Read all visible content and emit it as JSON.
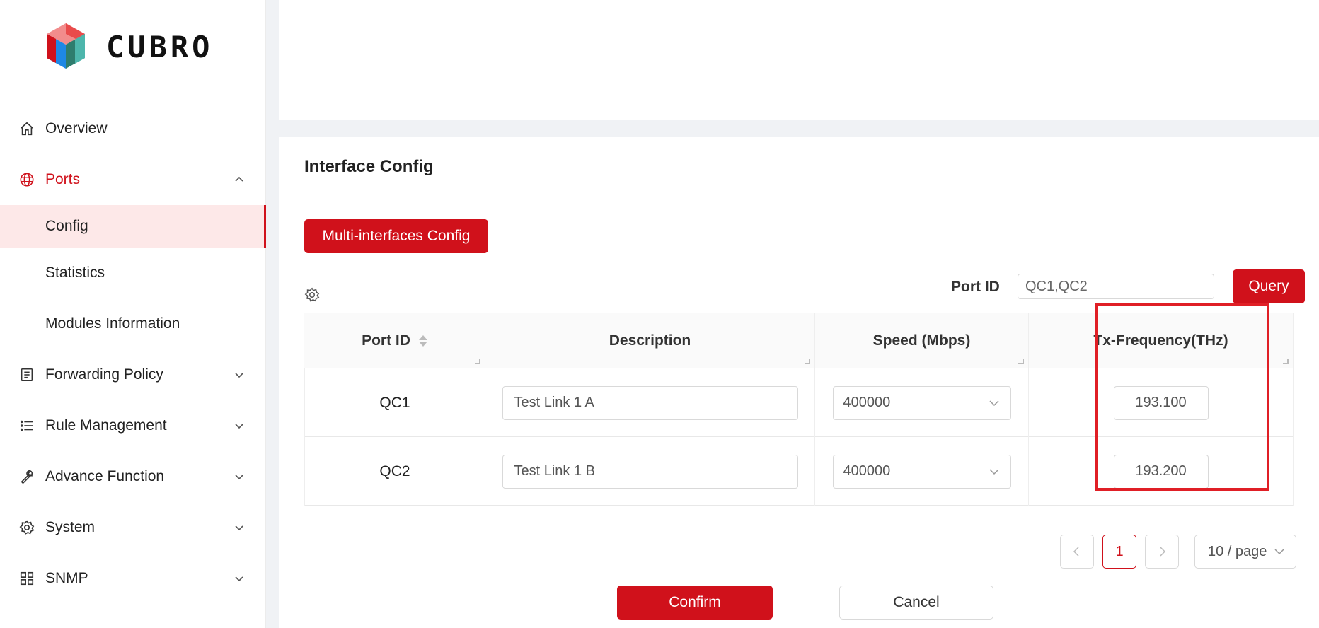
{
  "brand": {
    "name": "CUBRO",
    "colors": {
      "accent": "#d0111b",
      "highlight": "#e01f26",
      "selected_bg": "#fde8e8"
    }
  },
  "sidebar": {
    "items": [
      {
        "label": "Overview",
        "icon": "home-icon"
      },
      {
        "label": "Ports",
        "icon": "globe-icon",
        "expanded": true,
        "children": [
          {
            "label": "Config",
            "selected": true
          },
          {
            "label": "Statistics"
          },
          {
            "label": "Modules Information"
          }
        ]
      },
      {
        "label": "Forwarding Policy",
        "icon": "list-doc-icon"
      },
      {
        "label": "Rule Management",
        "icon": "list-icon"
      },
      {
        "label": "Advance Function",
        "icon": "wrench-icon"
      },
      {
        "label": "System",
        "icon": "gear-icon"
      },
      {
        "label": "SNMP",
        "icon": "grid-icon"
      }
    ]
  },
  "main": {
    "title": "Interface Config",
    "multi_button": "Multi-interfaces Config",
    "filter": {
      "label": "Port ID",
      "value": "QC1,QC2",
      "query_button": "Query"
    },
    "table": {
      "columns": [
        "Port ID",
        "Description",
        "Speed (Mbps)",
        "Tx-Frequency(THz)"
      ],
      "rows": [
        {
          "port_id": "QC1",
          "description": "Test Link 1 A",
          "speed": "400000",
          "tx_frequency": "193.100"
        },
        {
          "port_id": "QC2",
          "description": "Test Link 1 B",
          "speed": "400000",
          "tx_frequency": "193.200"
        }
      ]
    },
    "pagination": {
      "current_page": "1",
      "page_size": "10 / page"
    },
    "confirm_button": "Confirm",
    "cancel_button": "Cancel"
  }
}
